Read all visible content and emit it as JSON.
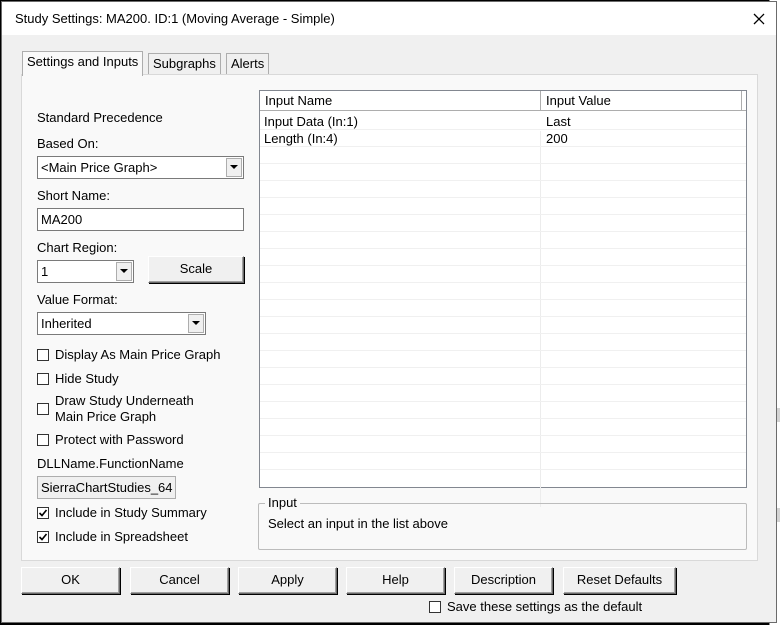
{
  "window": {
    "title": "Study Settings: MA200. ID:1 (Moving Average - Simple)"
  },
  "tabs": [
    {
      "label": "Settings and Inputs",
      "active": true
    },
    {
      "label": "Subgraphs",
      "active": false
    },
    {
      "label": "Alerts",
      "active": false
    }
  ],
  "settings": {
    "standard_precedence": "Standard Precedence",
    "based_on_label": "Based On:",
    "based_on_value": "<Main Price Graph>",
    "short_name_label": "Short Name:",
    "short_name_value": "MA200",
    "chart_region_label": "Chart Region:",
    "chart_region_value": "1",
    "scale_button": "Scale",
    "value_format_label": "Value Format:",
    "value_format_value": "Inherited",
    "display_as_main": {
      "label": "Display As Main Price Graph",
      "checked": false
    },
    "hide_study": {
      "label": "Hide Study",
      "checked": false
    },
    "draw_underneath": {
      "label_line1": "Draw Study Underneath",
      "label_line2": "Main Price Graph",
      "checked": false
    },
    "protect_password": {
      "label": "Protect with Password",
      "checked": false
    },
    "dll_label": "DLLName.FunctionName",
    "dll_value": "SierraChartStudies_64",
    "include_summary": {
      "label": "Include in Study Summary",
      "checked": true
    },
    "include_spreadsheet": {
      "label": "Include in Spreadsheet",
      "checked": true
    }
  },
  "inputs_table": {
    "columns": [
      "Input Name",
      "Input Value"
    ],
    "rows": [
      {
        "name": "Input Data  (In:1)",
        "value": "Last"
      },
      {
        "name": "Length  (In:4)",
        "value": "200"
      }
    ]
  },
  "input_group": {
    "title": "Input",
    "text": "Select an input in the list above"
  },
  "buttons": {
    "ok": "OK",
    "cancel": "Cancel",
    "apply": "Apply",
    "help": "Help",
    "description": "Description",
    "reset_defaults": "Reset Defaults"
  },
  "save_default": {
    "label": "Save these settings as the default",
    "checked": false
  },
  "colors": {
    "dialog_bg": "#f0f0f0",
    "panel_bg": "#f9f9f9",
    "selection_blue": "#0a64d6"
  }
}
